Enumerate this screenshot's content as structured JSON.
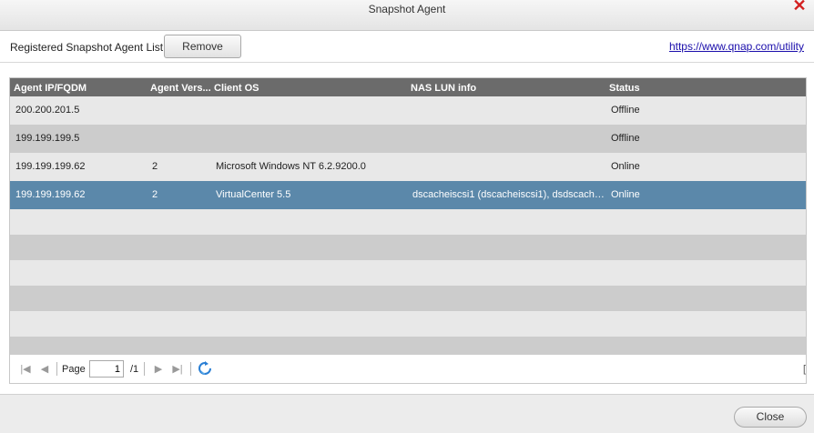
{
  "window": {
    "title": "Snapshot Agent",
    "close_icon": "close-icon"
  },
  "toolbar": {
    "list_label": "Registered Snapshot Agent List",
    "remove_label": "Remove",
    "utility_link": "https://www.qnap.com/utility"
  },
  "table": {
    "columns": [
      "Agent IP/FQDM",
      "Agent Vers...",
      "Client OS",
      "NAS LUN info",
      "Status"
    ],
    "rows": [
      {
        "ip": "200.200.201.5",
        "version": "",
        "os": "",
        "lun": "",
        "status": "Offline"
      },
      {
        "ip": "199.199.199.5",
        "version": "",
        "os": "",
        "lun": "",
        "status": "Offline"
      },
      {
        "ip": "199.199.199.62",
        "version": "2",
        "os": "Microsoft Windows NT 6.2.9200.0",
        "lun": "",
        "status": "Online"
      },
      {
        "ip": "199.199.199.62",
        "version": "2",
        "os": "VirtualCenter 5.5",
        "lun": "dscacheiscsi1 (dscacheiscsi1), dsdscache...",
        "status": "Online",
        "selected": true
      }
    ]
  },
  "pager": {
    "page_label": "Page",
    "current_page": "1",
    "total_pages": "/1",
    "icons": [
      "first-page-icon",
      "prev-page-icon",
      "next-page-icon",
      "last-page-icon",
      "refresh-icon"
    ]
  },
  "footer": {
    "close_label": "Close"
  },
  "colors": {
    "header_bg": "#6b6b6b",
    "selected_row": "#5b88aa",
    "alt_row": "#cccccc",
    "close_x": "#d32020"
  }
}
